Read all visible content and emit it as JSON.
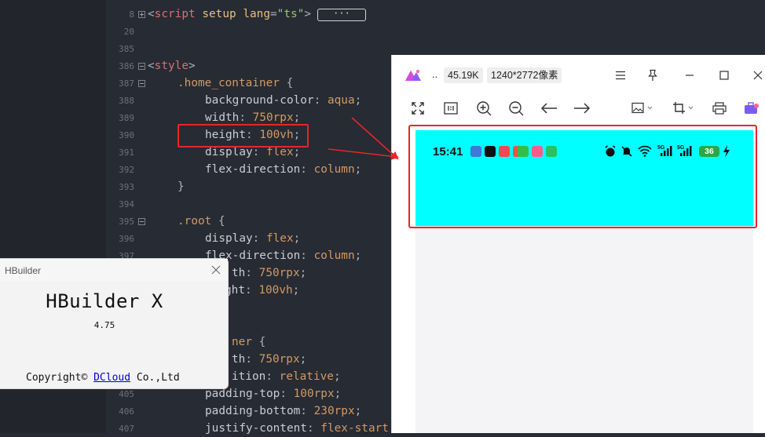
{
  "editor": {
    "lines": [
      {
        "num": "8",
        "fold": "plus"
      },
      {
        "num": "20",
        "fold": ""
      },
      {
        "num": "385",
        "fold": ""
      },
      {
        "num": "386",
        "fold": "minus"
      },
      {
        "num": "387",
        "fold": "minus"
      },
      {
        "num": "388",
        "fold": ""
      },
      {
        "num": "389",
        "fold": ""
      },
      {
        "num": "390",
        "fold": ""
      },
      {
        "num": "391",
        "fold": ""
      },
      {
        "num": "392",
        "fold": ""
      },
      {
        "num": "393",
        "fold": ""
      },
      {
        "num": "394",
        "fold": ""
      },
      {
        "num": "395",
        "fold": "minus"
      },
      {
        "num": "396",
        "fold": ""
      },
      {
        "num": "397",
        "fold": ""
      },
      {
        "num": "398",
        "fold": ""
      },
      {
        "num": "399",
        "fold": ""
      },
      {
        "num": "400",
        "fold": ""
      },
      {
        "num": "401",
        "fold": ""
      },
      {
        "num": "402",
        "fold": ""
      },
      {
        "num": "403",
        "fold": ""
      },
      {
        "num": "404",
        "fold": ""
      },
      {
        "num": "405",
        "fold": ""
      },
      {
        "num": "406",
        "fold": ""
      },
      {
        "num": "407",
        "fold": ""
      }
    ],
    "script_open": "<",
    "script_tag": "script",
    "script_attr1": "setup",
    "script_attr2": "lang",
    "script_eq": "=",
    "script_val": "\"ts\"",
    "script_close": ">",
    "collapsed_label": "···",
    "style_open": "<",
    "style_tag": "style",
    "style_close": ">",
    "sel_home": ".home_container",
    "brace_open": " {",
    "brace_close": "}",
    "p_bg": "background-color",
    "v_bg": "aqua",
    "p_width": "width",
    "v_750": "750rpx",
    "p_height": "height",
    "v_100vh": "100vh",
    "p_display": "display",
    "v_flex": "flex",
    "p_flexdir": "flex-direction",
    "v_column": "column",
    "sel_root": ".root",
    "frag_th": "th",
    "frag_ght": "ght",
    "frag_ner": "ner",
    "frag_dth": "dth",
    "frag_ition": "ition",
    "v_relative": "relative",
    "p_ptop": "padding-top",
    "v_100rpx": "100rpx",
    "p_pbottom": "padding-bottom",
    "v_230rpx": "230rpx",
    "p_justify": "justify-content",
    "v_flexstart": "flex-start",
    "colon": ": ",
    "semi": ";"
  },
  "viewer": {
    "more": "..",
    "file_size": "45.19K",
    "dimensions": "1240*2772像素",
    "clock": "15:41",
    "battery": "36",
    "accent": "#7b5cf0",
    "preview_color": "#00ffff"
  },
  "about": {
    "window_title": "HBuilder",
    "app_name": "HBuilder X",
    "version": "4.75",
    "copyright_prefix": "Copyright© ",
    "company_link": "DCloud",
    "copyright_suffix": " Co.,Ltd"
  },
  "annotations": {
    "highlight_color": "#e4262b"
  }
}
